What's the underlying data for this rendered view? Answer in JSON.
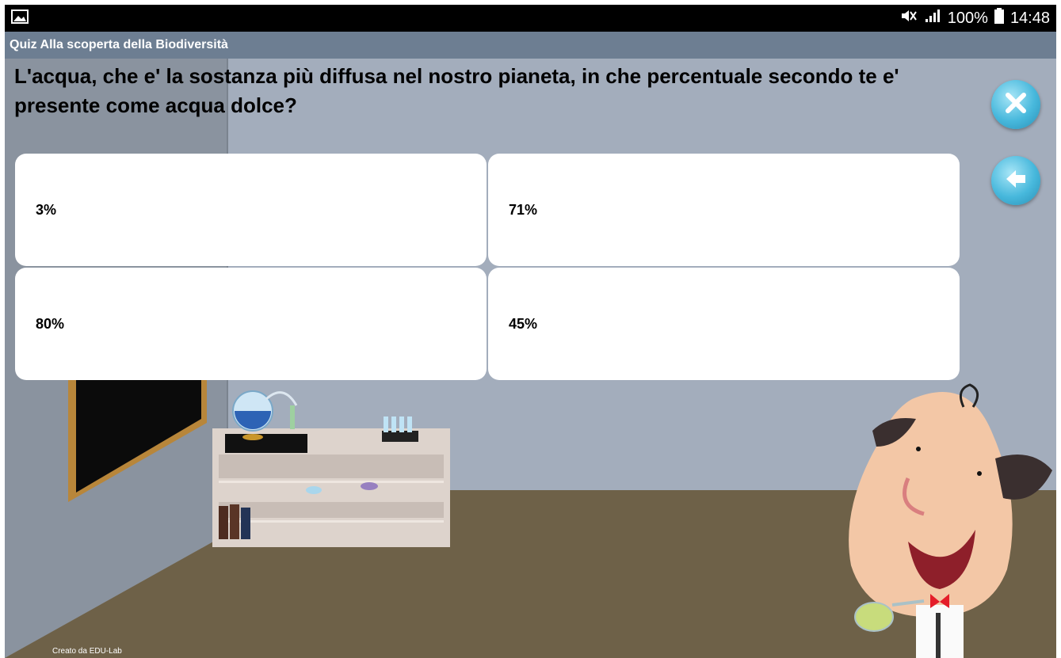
{
  "status_bar": {
    "battery": "100%",
    "time": "14:48",
    "icons": [
      "image-notification-icon",
      "mute-icon",
      "signal-icon",
      "battery-icon"
    ]
  },
  "app": {
    "title": "Quiz Alla scoperta della Biodiversità"
  },
  "quiz": {
    "question": "L'acqua, che e' la sostanza più diffusa nel nostro pianeta, in che percentuale secondo te e' presente come acqua dolce?",
    "answers": [
      "3%",
      "71%",
      "80%",
      "45%"
    ]
  },
  "controls": {
    "close_icon": "close-icon",
    "back_icon": "arrow-left-icon"
  },
  "footer": {
    "credit": "Creato da  EDU-Lab"
  },
  "colors": {
    "title_bar": "#6d7e92",
    "wall": "#a3adbc",
    "floor": "#6e6148",
    "button": "#47b8dc"
  }
}
